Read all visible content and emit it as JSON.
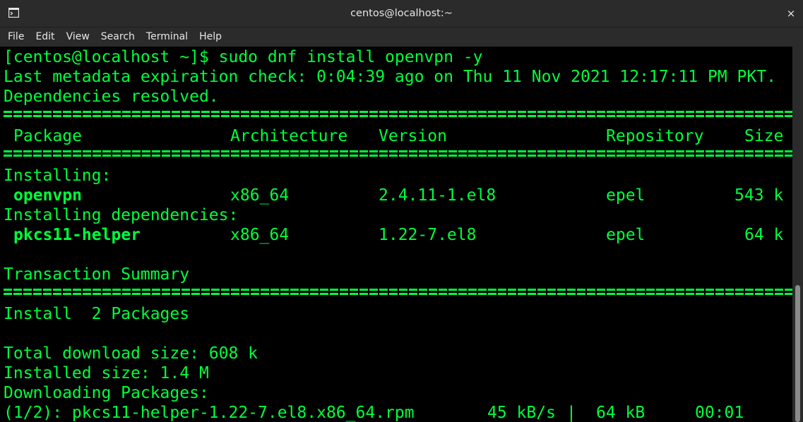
{
  "window": {
    "title": "centos@localhost:~",
    "close_glyph": "×"
  },
  "menu": [
    "File",
    "Edit",
    "View",
    "Search",
    "Terminal",
    "Help"
  ],
  "colors": {
    "terminal_text": "#00ff3c",
    "package_name": "#c3d82b",
    "background": "#000000",
    "chrome": "#2b2b2b"
  },
  "terminal": {
    "prompt": "[centos@localhost ~]$ sudo dnf install openvpn -y",
    "metadata": "Last metadata expiration check: 0:04:39 ago on Thu 11 Nov 2021 12:17:11 PM PKT.",
    "resolved": "Dependencies resolved.",
    "headers": {
      "package": "Package",
      "architecture": "Architecture",
      "version": "Version",
      "repository": "Repository",
      "size": "Size"
    },
    "installing_label": "Installing:",
    "row1": {
      "package": "openvpn",
      "arch": "x86_64",
      "version": "2.4.11-1.el8",
      "repo": "epel",
      "size": "543 k"
    },
    "deps_label": "Installing dependencies:",
    "row2": {
      "package": "pkcs11-helper",
      "arch": "x86_64",
      "version": "1.22-7.el8",
      "repo": "epel",
      "size": "64 k"
    },
    "summary_label": "Transaction Summary",
    "install_count": "Install  2 Packages",
    "total_download": "Total download size: 608 k",
    "installed_size": "Installed size: 1.4 M",
    "downloading": "Downloading Packages:",
    "progress": {
      "file": "(1/2): pkcs11-helper-1.22-7.el8.x86_64.rpm",
      "speed": "45 kB/s",
      "divider": "|",
      "size": "64 kB",
      "time": "00:01"
    }
  },
  "scrollbar": {
    "position_fraction": 0.64
  }
}
